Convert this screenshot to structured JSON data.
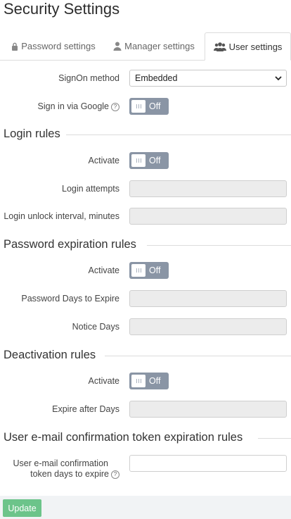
{
  "page": {
    "title": "Security Settings"
  },
  "tabs": [
    {
      "label": "Password settings",
      "icon": "lock-icon"
    },
    {
      "label": "Manager settings",
      "icon": "person-icon"
    },
    {
      "label": "User settings",
      "icon": "users-icon",
      "active": true
    }
  ],
  "signon": {
    "method_label": "SignOn method",
    "method_value": "Embedded",
    "google_label": "Sign in via Google",
    "google_toggle": "Off"
  },
  "login_rules": {
    "title": "Login rules",
    "activate_label": "Activate",
    "activate_toggle": "Off",
    "attempts_label": "Login attempts",
    "unlock_label": "Login unlock interval, minutes"
  },
  "password_expiration": {
    "title": "Password expiration rules",
    "activate_label": "Activate",
    "activate_toggle": "Off",
    "days_label": "Password Days to Expire",
    "notice_label": "Notice Days"
  },
  "deactivation": {
    "title": "Deactivation rules",
    "activate_label": "Activate",
    "activate_toggle": "Off",
    "expire_label": "Expire after Days"
  },
  "email_token": {
    "title": "User e-mail confirmation token expiration rules",
    "days_label_line1": "User e-mail confirmation",
    "days_label_line2": "token days to expire"
  },
  "help_glyph": "?",
  "footer": {
    "update_label": "Update"
  },
  "colors": {
    "toggle_off": "#8a95a5",
    "update_button": "#6cc48a"
  }
}
